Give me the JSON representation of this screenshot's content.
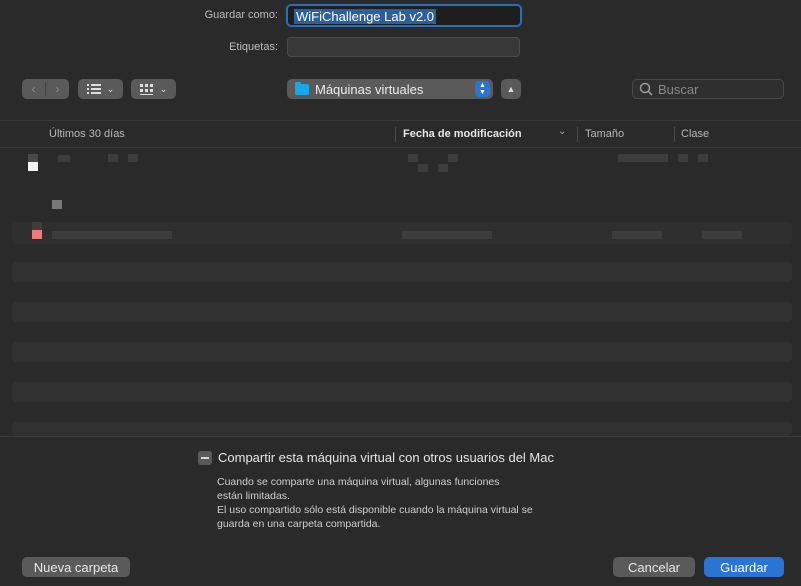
{
  "form": {
    "save_as_label": "Guardar como:",
    "save_as_value": "WiFiChallenge Lab v2.0",
    "tags_label": "Etiquetas:",
    "tags_value": ""
  },
  "toolbar": {
    "back_icon": "chevron-left-icon",
    "forward_icon": "chevron-right-icon",
    "list_view_icon": "list-view-icon",
    "grid_view_icon": "grid-view-icon",
    "location": "Máquinas virtuales",
    "location_icon": "folder-icon",
    "collapse_icon": "chevron-up-icon",
    "search_placeholder": "Buscar"
  },
  "columns": {
    "name": "Últimos 30 días",
    "date": "Fecha de modificación",
    "size": "Tamaño",
    "kind": "Clase"
  },
  "share": {
    "checkbox_label": "Compartir esta máquina virtual con otros usuarios del Mac",
    "info_line1": "Cuando se comparte una máquina virtual, algunas funciones",
    "info_line2": "están limitadas.",
    "info_line3": "El uso compartido sólo está disponible cuando la máquina virtual se",
    "info_line4": "guarda en una carpeta compartida."
  },
  "buttons": {
    "new_folder": "Nueva carpeta",
    "cancel": "Cancelar",
    "save": "Guardar"
  },
  "colors": {
    "accent": "#2a74d6",
    "window_bg": "#2a2a2a",
    "folder": "#1aa7e9"
  }
}
